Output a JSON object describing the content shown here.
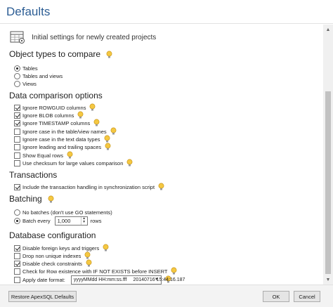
{
  "window": {
    "title": "Defaults"
  },
  "header": {
    "text": "Initial settings for newly created projects"
  },
  "object_types": {
    "title": "Object types to compare",
    "options": [
      {
        "label": "Tables",
        "checked": true
      },
      {
        "label": "Tables and views",
        "checked": false
      },
      {
        "label": "Views",
        "checked": false
      }
    ]
  },
  "data_comparison": {
    "title": "Data comparison options",
    "options": [
      {
        "label": "Ignore ROWGUID columns",
        "checked": true
      },
      {
        "label": "Ignore BLOB columns",
        "checked": true
      },
      {
        "label": "Ignore TIMESTAMP columns",
        "checked": true
      },
      {
        "label": "Ignore case in the table/view names",
        "checked": false
      },
      {
        "label": "Ignore case in the text data types",
        "checked": false
      },
      {
        "label": "Ignore leading and trailing spaces",
        "checked": false
      },
      {
        "label": "Show Equal rows",
        "checked": false
      },
      {
        "label": "Use checksum for large values comparison",
        "checked": false
      }
    ]
  },
  "transactions": {
    "title": "Transactions",
    "options": [
      {
        "label": "Include the transaction handling in synchronization script",
        "checked": true
      }
    ]
  },
  "batching": {
    "title": "Batching",
    "no_batches_label": "No batches (don't use GO statements)",
    "batch_every_label": "Batch every",
    "batch_value": "1,000",
    "rows_label": "rows",
    "selected": "batch_every"
  },
  "database_configuration": {
    "title": "Database configuration",
    "options": [
      {
        "label": "Disable foreign keys and triggers",
        "checked": true
      },
      {
        "label": "Drop non unique indexes",
        "checked": false
      },
      {
        "label": "Disable check constraints",
        "checked": true
      },
      {
        "label": "Check for Row existence with IF NOT EXISTS before INSERT",
        "checked": false
      }
    ],
    "date_format": {
      "label": "Apply date format:",
      "checked": false,
      "format": "yyyyMMdd HH:mm:ss.fff",
      "preview": "20140716 15:44:16.187"
    }
  },
  "footer": {
    "restore_label": "Restore ApexSQL Defaults",
    "ok_label": "OK",
    "cancel_label": "Cancel"
  }
}
